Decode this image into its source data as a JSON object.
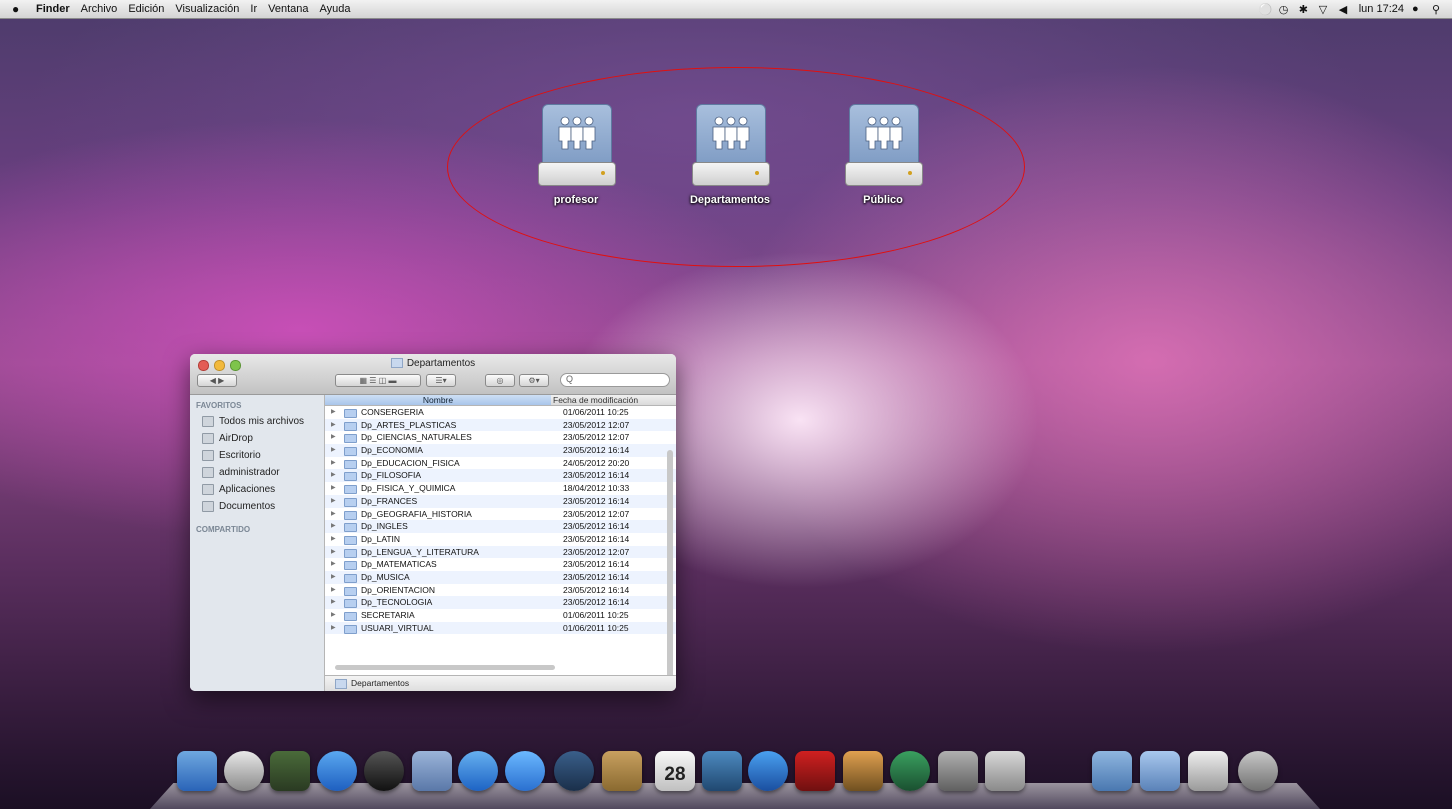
{
  "menubar": {
    "items": [
      "Finder",
      "Archivo",
      "Edición",
      "Visualización",
      "Ir",
      "Ventana",
      "Ayuda"
    ],
    "clock": "lun 17:24"
  },
  "desktop": {
    "icons": [
      "profesor",
      "Departamentos",
      "Público"
    ]
  },
  "finder": {
    "title": "Departamentos",
    "search_placeholder": "Q",
    "sidebar": {
      "favorites_header": "FAVORITOS",
      "items": [
        "Todos mis archivos",
        "AirDrop",
        "Escritorio",
        "administrador",
        "Aplicaciones",
        "Documentos"
      ],
      "shared_header": "COMPARTIDO"
    },
    "columns": {
      "name": "Nombre",
      "date": "Fecha de modificación"
    },
    "rows": [
      {
        "name": "CONSERGERIA",
        "date": "01/06/2011 10:25"
      },
      {
        "name": "Dp_ARTES_PLASTICAS",
        "date": "23/05/2012 12:07"
      },
      {
        "name": "Dp_CIENCIAS_NATURALES",
        "date": "23/05/2012 12:07"
      },
      {
        "name": "Dp_ECONOMIA",
        "date": "23/05/2012 16:14"
      },
      {
        "name": "Dp_EDUCACION_FISICA",
        "date": "24/05/2012 20:20"
      },
      {
        "name": "Dp_FILOSOFIA",
        "date": "23/05/2012 16:14"
      },
      {
        "name": "Dp_FISICA_Y_QUIMICA",
        "date": "18/04/2012 10:33"
      },
      {
        "name": "Dp_FRANCES",
        "date": "23/05/2012 16:14"
      },
      {
        "name": "Dp_GEOGRAFIA_HISTORIA",
        "date": "23/05/2012 12:07"
      },
      {
        "name": "Dp_INGLES",
        "date": "23/05/2012 16:14"
      },
      {
        "name": "Dp_LATIN",
        "date": "23/05/2012 16:14"
      },
      {
        "name": "Dp_LENGUA_Y_LITERATURA",
        "date": "23/05/2012 12:07"
      },
      {
        "name": "Dp_MATEMATICAS",
        "date": "23/05/2012 16:14"
      },
      {
        "name": "Dp_MUSICA",
        "date": "23/05/2012 16:14"
      },
      {
        "name": "Dp_ORIENTACION",
        "date": "23/05/2012 16:14"
      },
      {
        "name": "Dp_TECNOLOGIA",
        "date": "23/05/2012 16:14"
      },
      {
        "name": "SECRETARIA",
        "date": "01/06/2011 10:25"
      },
      {
        "name": "USUARI_VIRTUAL",
        "date": "01/06/2011 10:25"
      }
    ],
    "path": "Departamentos"
  },
  "dock": {
    "calendar_day": "28",
    "icons": [
      "finder-icon",
      "dvd-player-icon",
      "dashboard-icon",
      "app-store-icon",
      "clock-icon",
      "mail-icon",
      "safari-icon",
      "ichat-icon",
      "facetime-icon",
      "address-book-icon",
      "ical-icon",
      "iphoto-icon",
      "itunes-icon",
      "photo-booth-icon",
      "iphoto-2-icon",
      "time-machine-icon",
      "system-preferences-icon",
      "preview-icon",
      "applications-folder-icon",
      "documents-folder-icon",
      "downloads-icon",
      "trash-icon"
    ]
  }
}
